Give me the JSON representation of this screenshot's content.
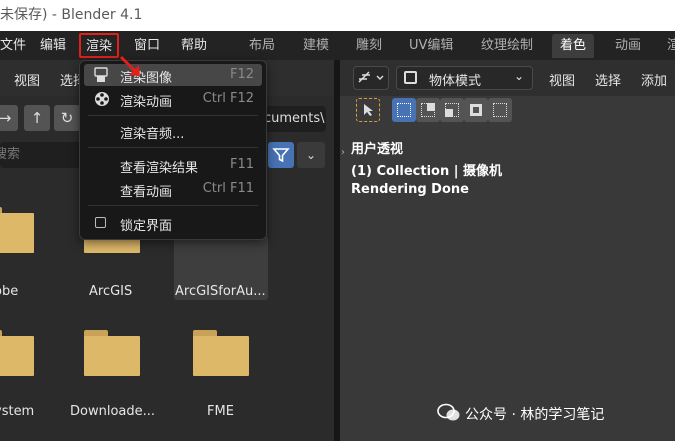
{
  "window": {
    "title": "未保存) - Blender 4.1"
  },
  "menubar": {
    "items": [
      "文件",
      "编辑",
      "渲染",
      "窗口",
      "帮助"
    ],
    "active": "渲染"
  },
  "workspaces": {
    "tabs": [
      "布局",
      "建模",
      "雕刻",
      "UV编辑",
      "纹理绘制",
      "着色",
      "动画",
      "渲"
    ],
    "active": "着色"
  },
  "file_browser": {
    "header": [
      "视图",
      "选择"
    ],
    "nav_icons": [
      "arrow-right-icon",
      "arrow-up-icon",
      "refresh-icon"
    ],
    "path": "cuments\\",
    "search_placeholder": "搜索",
    "folders": [
      "obe",
      "ArcGIS",
      "ArcGISforAu...",
      "ystem",
      "Downloade...",
      "FME"
    ],
    "selected": "ArcGISforAu..."
  },
  "render_menu": {
    "items": [
      {
        "label": "渲染图像",
        "shortcut": "F12",
        "icon": "render-image-icon",
        "highlighted": true
      },
      {
        "label": "渲染动画",
        "shortcut": "Ctrl F12",
        "icon": "film-reel-icon"
      },
      {
        "label": "渲染音频...",
        "shortcut": ""
      },
      {
        "label": "查看渲染结果",
        "shortcut": "F11"
      },
      {
        "label": "查看动画",
        "shortcut": "Ctrl F11"
      },
      {
        "label": "锁定界面",
        "shortcut": "",
        "checkbox": true,
        "checked": false
      }
    ]
  },
  "viewport": {
    "mode": "物体模式",
    "header": [
      "视图",
      "选择",
      "添加"
    ],
    "overlay": [
      "用户透视",
      "(1) Collection | 摄像机",
      "Rendering Done"
    ]
  },
  "watermark": {
    "text": "公众号 · 林的学习笔记"
  },
  "colors": {
    "accent": "#4772b3",
    "highlight_border": "#e0201a",
    "folder": "#deb869"
  }
}
